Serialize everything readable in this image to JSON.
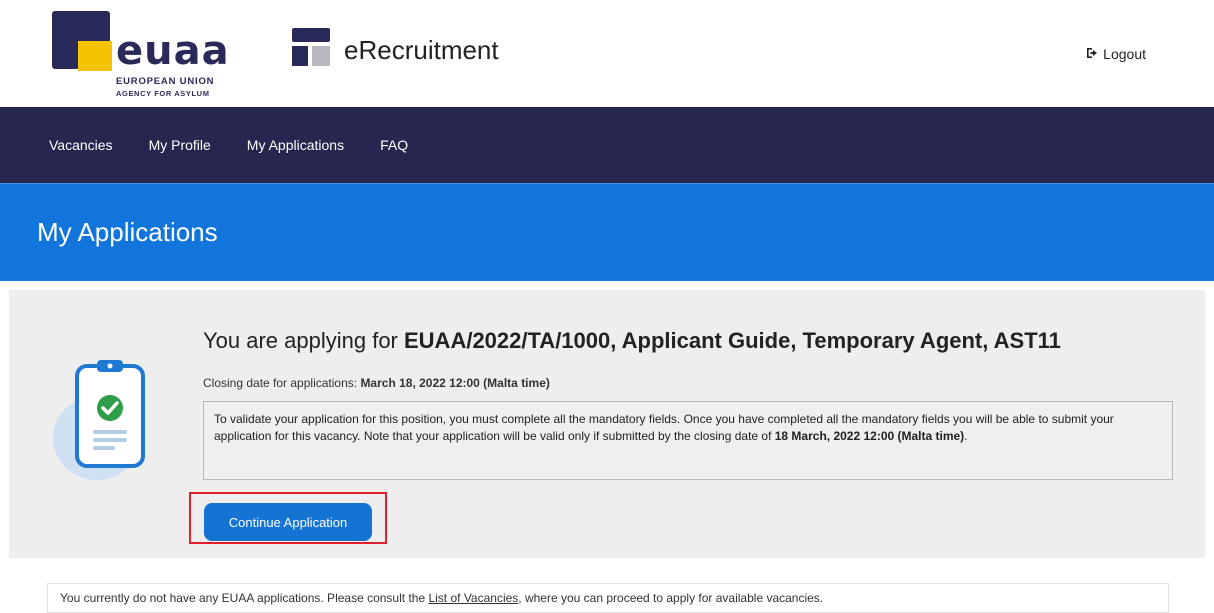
{
  "header": {
    "logo_word": "euaa",
    "logo_sub1": "EUROPEAN UNION",
    "logo_sub2": "AGENCY FOR ASYLUM",
    "app_title": "eRecruitment",
    "logout_label": "Logout",
    "logout_icon": "sign-out-icon"
  },
  "nav": {
    "items": [
      {
        "label": "Vacancies"
      },
      {
        "label": "My Profile"
      },
      {
        "label": "My Applications"
      },
      {
        "label": "FAQ"
      }
    ]
  },
  "banner": {
    "title": "My Applications"
  },
  "application": {
    "prefix": "You are applying for ",
    "vacancy": "EUAA/2022/TA/1000, Applicant Guide, Temporary Agent, AST11",
    "closing_prefix": "Closing date for applications: ",
    "closing_date": "March 18, 2022 12:00 (Malta time)",
    "notice_text": "To validate your application for this position, you must complete all the mandatory fields. Once you have completed all the mandatory fields you will be able to submit your application for this vacancy. Note that your application will be valid only if submitted by the closing date of ",
    "notice_deadline": "18 March, 2022 12:00 (Malta time)",
    "notice_end": ".",
    "continue_label": "Continue Application"
  },
  "footer_note": {
    "text_before": "You currently do not have any EUAA applications. Please consult the ",
    "link": "List of Vacancies",
    "text_after": ", where you can proceed to apply for available vacancies."
  },
  "colors": {
    "nav_bg": "#26264f",
    "banner_bg": "#1275dc",
    "button_bg": "#1473d3",
    "highlight": "#e0202e",
    "logo_yellow": "#f5c400"
  }
}
